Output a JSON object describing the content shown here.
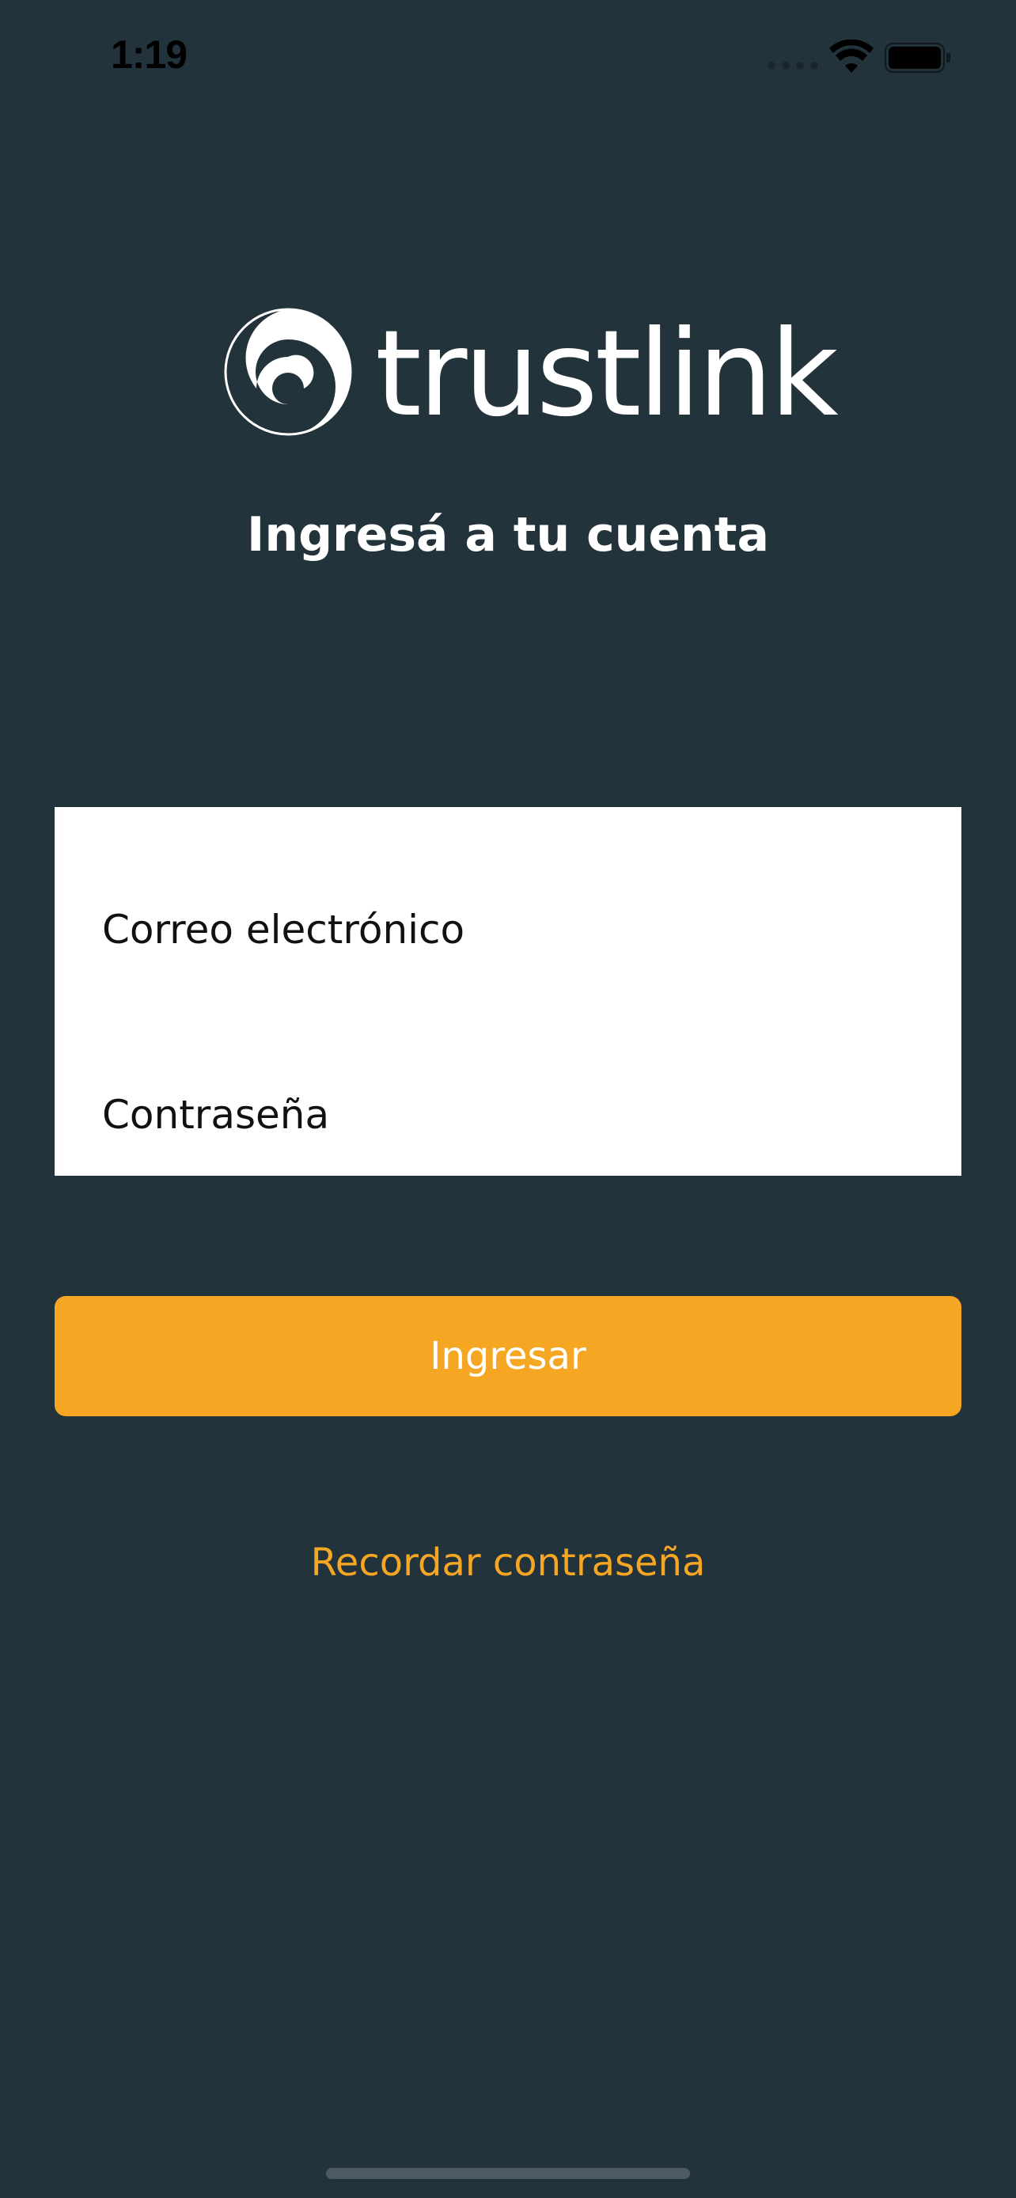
{
  "status_bar": {
    "time": "1:19",
    "signal_icon": "cellular-signal-icon",
    "wifi_icon": "wifi-icon",
    "battery_icon": "battery-icon"
  },
  "logo": {
    "icon": "spiral-logo-icon",
    "wordmark": "trustlink"
  },
  "title": "Ingresá a tu cuenta",
  "form": {
    "email_placeholder": "Correo electrónico",
    "password_placeholder": "Contraseña"
  },
  "submit_label": "Ingresar",
  "forgot_password_label": "Recordar contraseña",
  "colors": {
    "background": "#23333c",
    "accent": "#f5a623",
    "card": "#ffffff"
  }
}
